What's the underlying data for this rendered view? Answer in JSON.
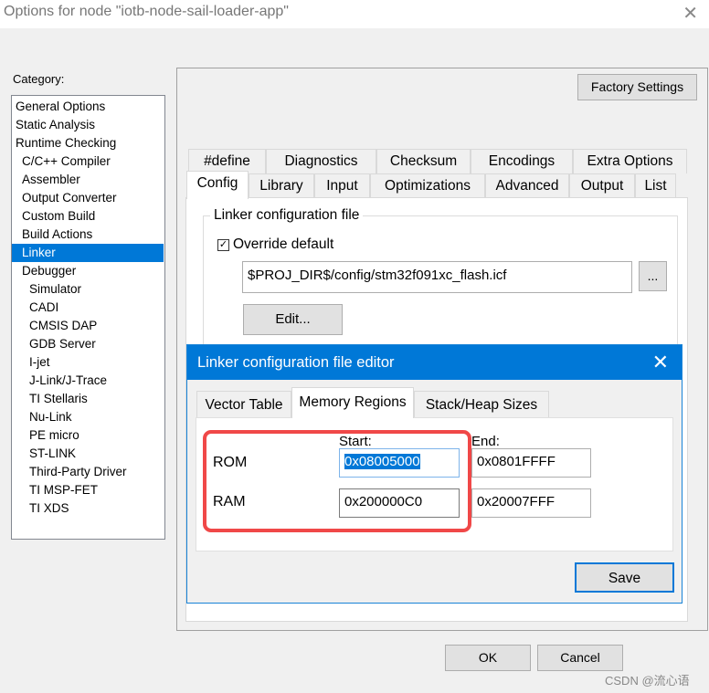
{
  "window": {
    "title": "Options for node \"iotb-node-sail-loader-app\"",
    "close_icon": "close-icon"
  },
  "category": {
    "label": "Category:",
    "selected": "Linker",
    "items": [
      {
        "label": "General Options",
        "level": 0
      },
      {
        "label": "Static Analysis",
        "level": 0
      },
      {
        "label": "Runtime Checking",
        "level": 0
      },
      {
        "label": "C/C++ Compiler",
        "level": 1
      },
      {
        "label": "Assembler",
        "level": 1
      },
      {
        "label": "Output Converter",
        "level": 1
      },
      {
        "label": "Custom Build",
        "level": 1
      },
      {
        "label": "Build Actions",
        "level": 1
      },
      {
        "label": "Linker",
        "level": 1
      },
      {
        "label": "Debugger",
        "level": 1
      },
      {
        "label": "Simulator",
        "level": 2
      },
      {
        "label": "CADI",
        "level": 2
      },
      {
        "label": "CMSIS DAP",
        "level": 2
      },
      {
        "label": "GDB Server",
        "level": 2
      },
      {
        "label": "I-jet",
        "level": 2
      },
      {
        "label": "J-Link/J-Trace",
        "level": 2
      },
      {
        "label": "TI Stellaris",
        "level": 2
      },
      {
        "label": "Nu-Link",
        "level": 2
      },
      {
        "label": "PE micro",
        "level": 2
      },
      {
        "label": "ST-LINK",
        "level": 2
      },
      {
        "label": "Third-Party Driver",
        "level": 2
      },
      {
        "label": "TI MSP-FET",
        "level": 2
      },
      {
        "label": "TI XDS",
        "level": 2
      }
    ]
  },
  "factory_settings": "Factory Settings",
  "tabs_row1": [
    "#define",
    "Diagnostics",
    "Checksum",
    "Encodings",
    "Extra Options"
  ],
  "tabs_row2": [
    "Config",
    "Library",
    "Input",
    "Optimizations",
    "Advanced",
    "Output",
    "List"
  ],
  "selected_tab": "Config",
  "config": {
    "group_label": "Linker configuration file",
    "override_label": "Override default",
    "override_checked": true,
    "file_path": "$PROJ_DIR$/config/stm32f091xc_flash.icf",
    "browse_label": "...",
    "edit_label": "Edit..."
  },
  "editor": {
    "title": "Linker configuration file editor",
    "tabs": [
      "Vector Table",
      "Memory Regions",
      "Stack/Heap Sizes"
    ],
    "selected_tab": "Memory Regions",
    "start_label": "Start:",
    "end_label": "End:",
    "rows": [
      {
        "name": "ROM",
        "start": "0x08005000",
        "end": "0x0801FFFF"
      },
      {
        "name": "RAM",
        "start": "0x200000C0",
        "end": "0x20007FFF"
      }
    ],
    "save_label": "Save",
    "highlight_color": "#f04848"
  },
  "ok_label": "OK",
  "cancel_label": "Cancel",
  "watermark": "CSDN @流心语"
}
